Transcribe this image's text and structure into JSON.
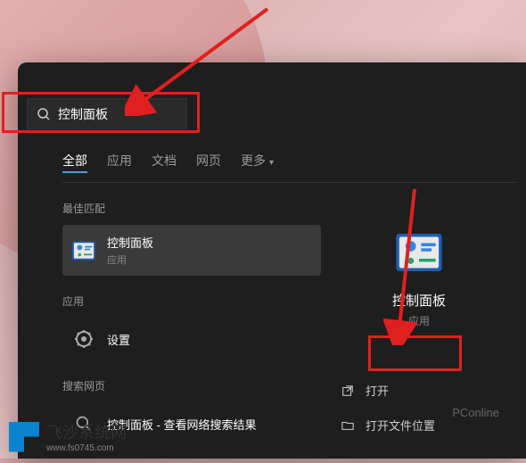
{
  "search": {
    "query": "控制面板"
  },
  "tabs": [
    {
      "label": "全部",
      "active": true
    },
    {
      "label": "应用",
      "active": false
    },
    {
      "label": "文档",
      "active": false
    },
    {
      "label": "网页",
      "active": false
    },
    {
      "label": "更多",
      "active": false,
      "hasChevron": true
    }
  ],
  "sections": {
    "bestMatch": {
      "label": "最佳匹配",
      "items": [
        {
          "title": "控制面板",
          "subtitle": "应用",
          "icon": "control-panel"
        }
      ]
    },
    "apps": {
      "label": "应用",
      "items": [
        {
          "title": "设置",
          "subtitle": "",
          "icon": "gear"
        }
      ]
    },
    "webSearch": {
      "label": "搜索网页",
      "items": [
        {
          "title": "控制面板 - 查看网络搜索结果",
          "icon": "search"
        }
      ]
    }
  },
  "detail": {
    "title": "控制面板",
    "subtitle": "应用",
    "actions": [
      {
        "label": "打开",
        "icon": "open"
      },
      {
        "label": "打开文件位置",
        "icon": "folder"
      }
    ]
  },
  "watermark": {
    "top": "PConline",
    "bottom": "飞沙系统网",
    "url": "www.fs0745.com"
  }
}
